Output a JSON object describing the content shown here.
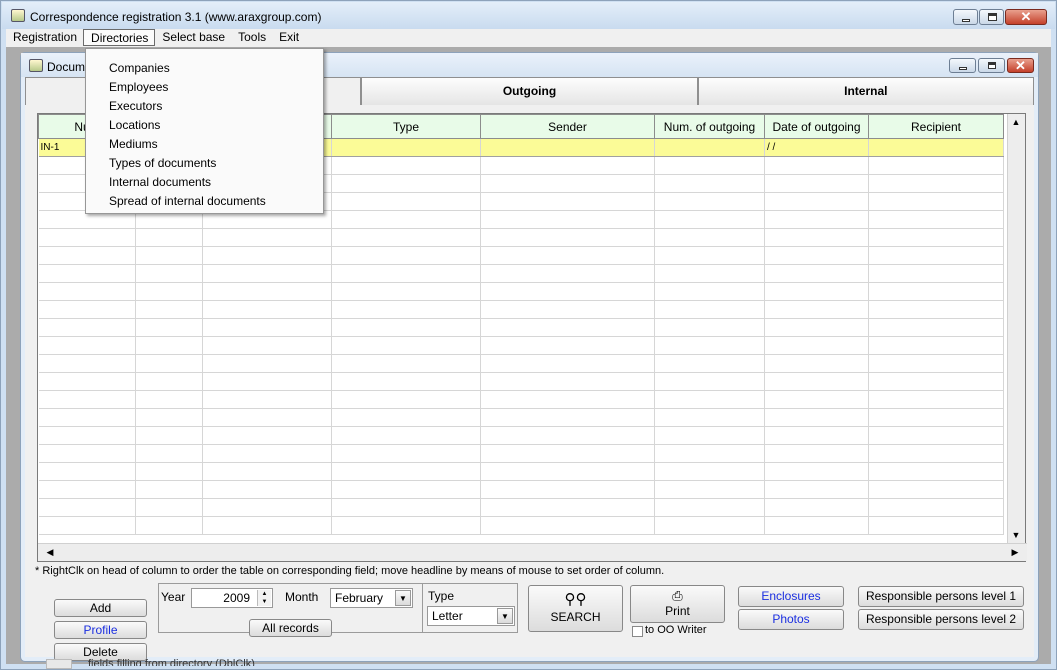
{
  "window": {
    "title": "Correspondence registration 3.1 (www.araxgroup.com)"
  },
  "menubar": {
    "items": [
      "Registration",
      "Directories",
      "Select base",
      "Tools",
      "Exit"
    ]
  },
  "directories_menu": {
    "items": [
      "Companies",
      "Employees",
      "Executors",
      "Locations",
      "Mediums",
      "Types of documents",
      "Internal documents",
      "Spread of internal documents"
    ]
  },
  "mdi": {
    "title": "Docum"
  },
  "tabs": [
    "",
    "Outgoing",
    "Internal"
  ],
  "grid": {
    "columns": [
      "Num",
      "",
      "",
      "Type",
      "Sender",
      "Num. of outgoing",
      "Date of outgoing",
      "Recipient"
    ],
    "current_row": [
      "IN-1",
      "",
      "",
      "",
      "",
      "",
      "/ /",
      ""
    ]
  },
  "hint": "* RightClk on head of column to order the table on corresponding field;  move  headline by means of mouse to set order of column.",
  "actions": {
    "add": "Add",
    "profile": "Profile",
    "delete": "Delete"
  },
  "filter": {
    "year_label": "Year",
    "year_value": "2009",
    "month_label": "Month",
    "month_value": "February",
    "type_label": "Type",
    "type_value": "Letter",
    "all_records": "All records"
  },
  "search": {
    "label": "SEARCH"
  },
  "print": {
    "label": "Print",
    "oo_writer": "to OO Writer"
  },
  "extras": {
    "enclosures": "Enclosures",
    "photos": "Photos"
  },
  "responsible": {
    "level1": "Responsible persons level 1",
    "level2": "Responsible persons level 2"
  },
  "status": {
    "text": "fields filling from directory (DblClk)"
  }
}
